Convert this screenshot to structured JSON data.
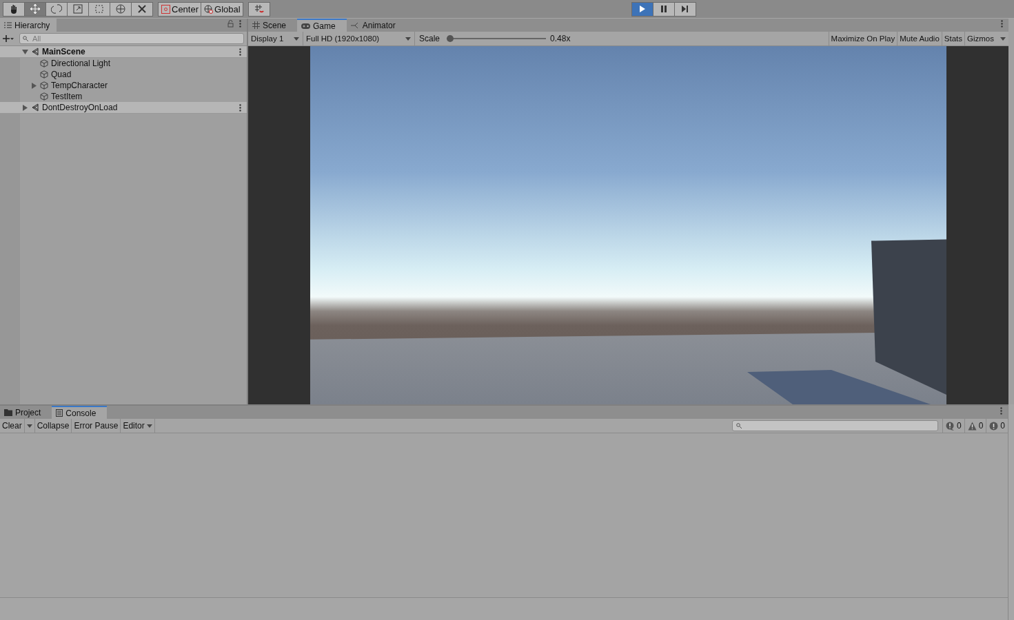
{
  "toolbar": {
    "tools": [
      {
        "kind": "hand",
        "selected": false
      },
      {
        "kind": "move",
        "selected": true
      },
      {
        "kind": "rotate",
        "selected": false
      },
      {
        "kind": "scale",
        "selected": false
      },
      {
        "kind": "rect",
        "selected": false
      },
      {
        "kind": "transform",
        "selected": false
      },
      {
        "kind": "custom",
        "selected": false
      }
    ],
    "pivot": [
      {
        "kind": "pivot",
        "label": "Center"
      },
      {
        "kind": "space",
        "label": "Global"
      }
    ],
    "playback": [
      {
        "kind": "play",
        "on": true
      },
      {
        "kind": "pause",
        "on": false
      },
      {
        "kind": "step",
        "on": false
      }
    ]
  },
  "hierarchy": {
    "tab": {
      "label": "Hierarchy",
      "selected": true
    },
    "search": {
      "placeholder": "All"
    },
    "items": [
      {
        "label": "MainScene",
        "kind": "scene",
        "expanded": true,
        "children": [
          {
            "label": "Directional Light",
            "kind": "object"
          },
          {
            "label": "Quad",
            "kind": "object"
          },
          {
            "label": "TempCharacter",
            "kind": "object",
            "expanded": false
          },
          {
            "label": "TestItem",
            "kind": "object"
          }
        ]
      },
      {
        "label": "DontDestroyOnLoad",
        "kind": "scene",
        "expanded": false
      }
    ]
  },
  "view_tabs": [
    {
      "label": "Scene",
      "kind": "scene",
      "selected": false
    },
    {
      "label": "Game",
      "kind": "game",
      "selected": true
    },
    {
      "label": "Animator",
      "kind": "animator",
      "selected": false
    }
  ],
  "game_toolbar": {
    "display": "Display 1",
    "resolution": "Full HD (1920x1080)",
    "scale_label": "Scale",
    "scale": {
      "level": 0.0
    },
    "scale_value": "0.48x",
    "buttons": [
      "Maximize On Play",
      "Mute Audio",
      "Stats",
      "Gizmos"
    ]
  },
  "bottom_tabs": [
    {
      "label": "Project",
      "kind": "project",
      "selected": false
    },
    {
      "label": "Console",
      "kind": "console",
      "selected": true
    }
  ],
  "console_toolbar": {
    "buttons": [
      {
        "label": "Clear",
        "dropdown": true
      },
      {
        "label": "Collapse",
        "dropdown": false
      },
      {
        "label": "Error Pause",
        "dropdown": false
      },
      {
        "label": "Editor",
        "dropdown": true
      }
    ],
    "counters": [
      {
        "kind": "log",
        "count": "0"
      },
      {
        "kind": "warning",
        "count": "0"
      },
      {
        "kind": "error",
        "count": "0"
      }
    ]
  }
}
